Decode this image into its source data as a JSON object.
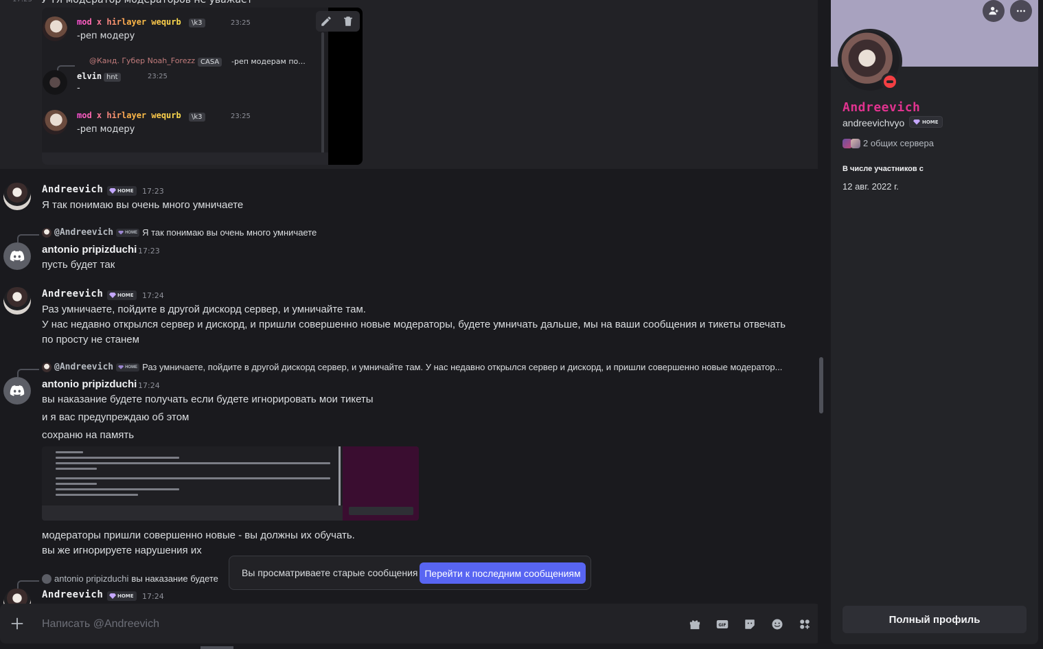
{
  "top": {
    "cut_text": "У ТЯ модератор модераторов не уважает",
    "embed": {
      "msg1": {
        "name": "mod x hirlayer wequrb",
        "tag": "\\k3",
        "time": "23:25",
        "text": "-реп модеру"
      },
      "reply": {
        "user": "@Канд. Губер Noah_Forezz",
        "tag": "CASA",
        "text": "-реп модерам по..."
      },
      "msg2": {
        "name": "elvin",
        "tag": "hnt",
        "time": "23:25",
        "text": "-"
      },
      "msg3": {
        "name": "mod x hirlayer wequrb",
        "tag": "\\k3",
        "time": "23:25",
        "text": "-реп модеру"
      }
    }
  },
  "badge_label": "HOME",
  "messages": {
    "m1": {
      "user": "Andreevich",
      "time": "17:23",
      "text": "Я так понимаю вы очень много умничаете"
    },
    "m2": {
      "reply_user": "@Andreevich",
      "reply_text": "Я так понимаю вы очень много умничаете",
      "user": "antonio pripizduchi",
      "time": "17:23",
      "text": "пусть будет так"
    },
    "m3": {
      "user": "Andreevich",
      "time": "17:24",
      "line1": "Раз умничаете, пойдите в другой дискорд сервер, и умничайте там.",
      "line2": "У нас недавно открылся сервер и дискорд, и пришли совершенно новые модераторы, будете умничать дальше, мы на ваши сообщения и тикеты отвечать",
      "line3": "по просту не станем"
    },
    "m4": {
      "reply_user": "@Andreevich",
      "reply_text": "Раз умничаете, пойдите в другой дискорд сервер, и умничайте там. У нас недавно открылся сервер и дискорд, и пришли совершенно новые модератор...",
      "user": "antonio pripizduchi",
      "time": "17:24",
      "line1": "вы наказание будете получать если будете игнорировать мои тикеты",
      "line2": "и я вас предупреждаю об этом",
      "line3": "сохраню на память",
      "line4": "модераторы пришли совершенно новые - вы должны их обучать.",
      "line5": "вы же игнорируете нарушения их"
    },
    "m5": {
      "reply_user": "antonio pripizduchi",
      "reply_text": "вы наказание будете",
      "user": "Andreevich",
      "time": "17:24"
    }
  },
  "notice": {
    "text": "Вы просматриваете старые сообщения",
    "button": "Перейти к последним сообщениям"
  },
  "composer": {
    "placeholder": "Написать @Andreevich"
  },
  "profile": {
    "display_name": "Andreevich",
    "username": "andreevichvyo",
    "badge": "HOME",
    "mutual": "2 общих сервера",
    "since_label": "В числе участников с",
    "since_date": "12 авг. 2022 г.",
    "full_profile": "Полный профиль"
  },
  "colors": {
    "accent": "#5865f2",
    "profile_name": "#e0338f",
    "banner": "#a8a2bf",
    "status_dnd": "#f23f43"
  }
}
